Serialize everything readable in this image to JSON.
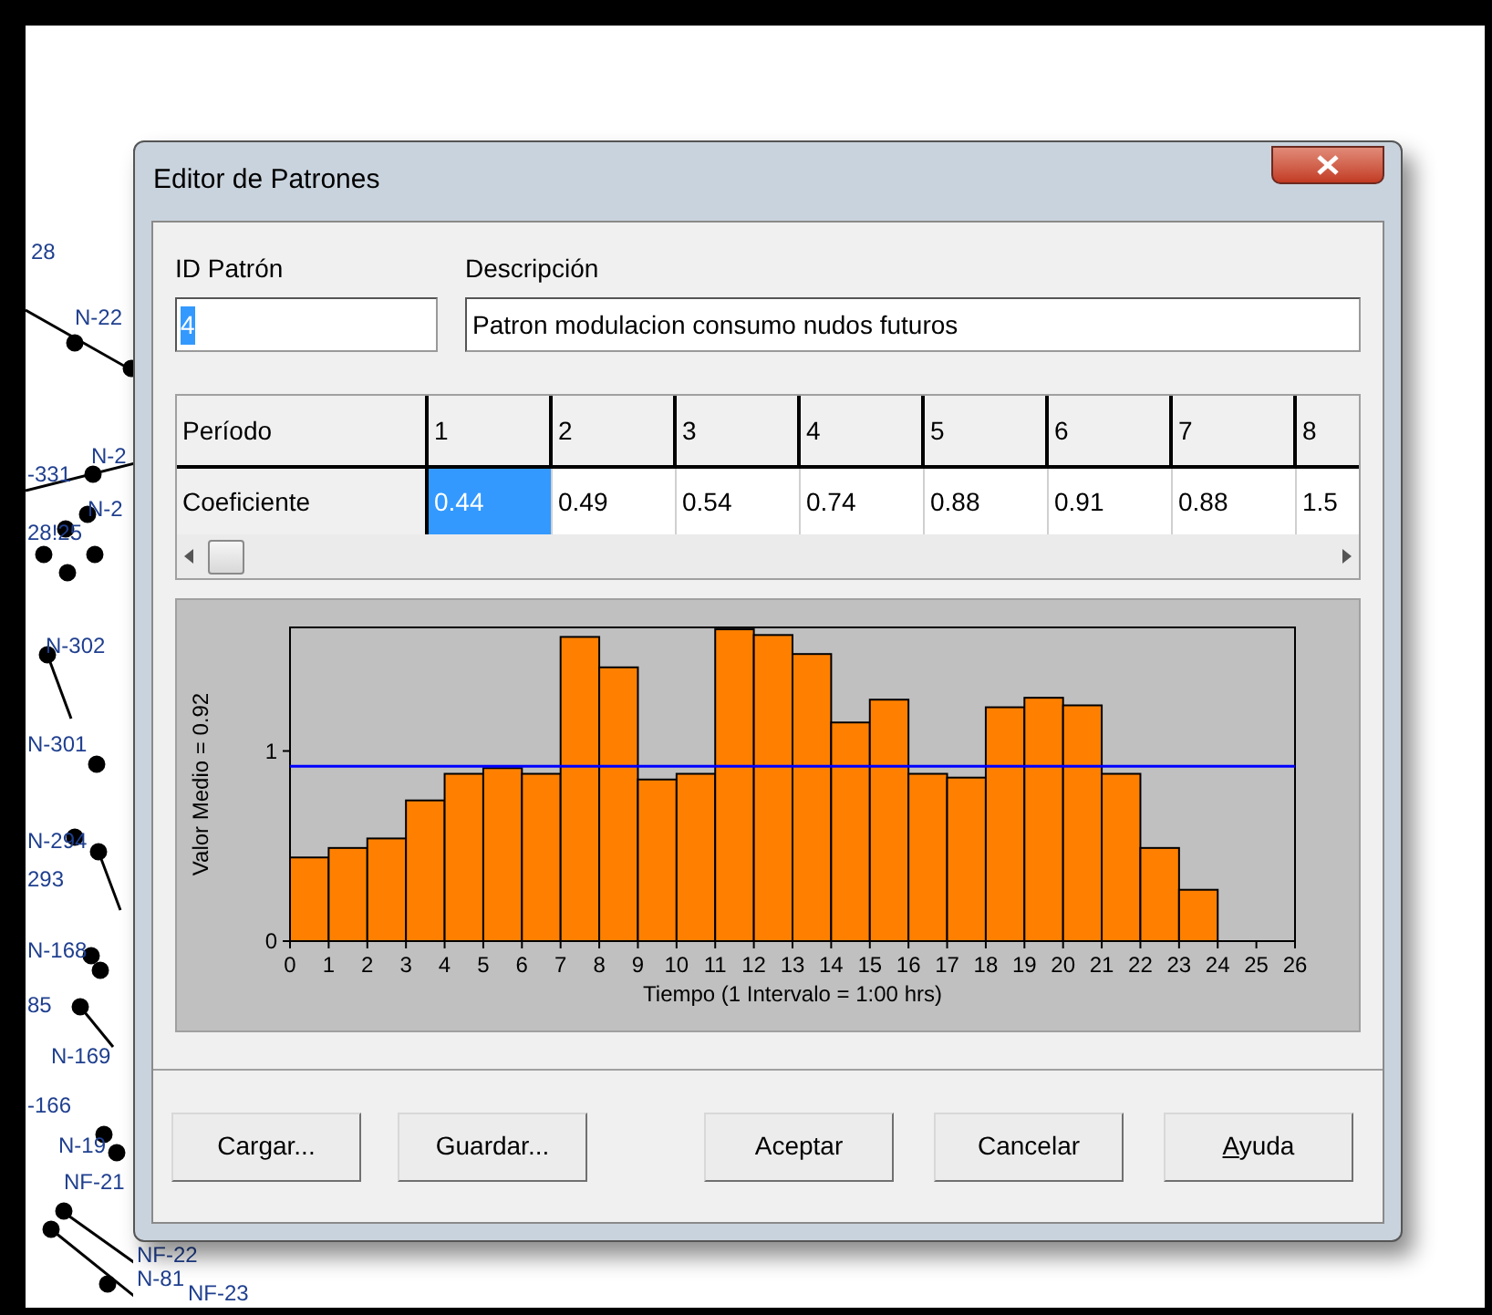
{
  "map": {
    "labels": [
      "28",
      "N-22",
      "-331",
      "N-2",
      "N-2",
      "28!25",
      "N-302",
      "N-301",
      "N-294",
      "293",
      "N-168",
      "85",
      "N-169",
      "-166",
      "N-19",
      "NF-21",
      "NF-22",
      "N-81",
      "NF-23"
    ]
  },
  "window": {
    "title": "Editor de Patrones"
  },
  "id_field": {
    "label": "ID Patrón",
    "value": "4",
    "highlighted": true
  },
  "description_field": {
    "label": "Descripción",
    "value": "Patron modulacion consumo nudos futuros"
  },
  "table": {
    "row_headers": [
      "Período",
      "Coeficiente"
    ],
    "periods": [
      "1",
      "2",
      "3",
      "4",
      "5",
      "6",
      "7",
      "8"
    ],
    "coefficients": [
      {
        "text": "0.44",
        "selected": true
      },
      {
        "text": "0.49",
        "selected": false
      },
      {
        "text": "0.54",
        "selected": false
      },
      {
        "text": "0.74",
        "selected": false
      },
      {
        "text": "0.88",
        "selected": false
      },
      {
        "text": "0.91",
        "selected": false
      },
      {
        "text": "0.88",
        "selected": false
      },
      {
        "text": "1.5",
        "selected": false
      }
    ]
  },
  "chart": {
    "chart_data": {
      "type": "bar",
      "xlabel": "Tiempo (1 Intervalo = 1:00  hrs)",
      "ylabel": "Valor Medio = 0.92",
      "x": [
        0.5,
        1.5,
        2.5,
        3.5,
        4.5,
        5.5,
        6.5,
        7.5,
        8.5,
        9.5,
        10.5,
        11.5,
        12.5,
        13.5,
        14.5,
        15.5,
        16.5,
        17.5,
        18.5,
        19.5,
        20.5,
        21.5,
        22.5,
        23.5
      ],
      "series": [
        {
          "color": "#ff8000",
          "values": [
            0.44,
            0.49,
            0.54,
            0.74,
            0.88,
            0.91,
            0.88,
            1.6,
            1.44,
            0.85,
            0.88,
            1.64,
            1.61,
            1.51,
            1.15,
            1.27,
            0.88,
            0.86,
            1.23,
            1.28,
            1.24,
            0.88,
            0.49,
            0.27
          ]
        }
      ],
      "xlim": [
        0,
        26
      ],
      "ylim": [
        0,
        1.65
      ],
      "xticks": [
        0,
        1,
        2,
        3,
        4,
        5,
        6,
        7,
        8,
        9,
        10,
        11,
        12,
        13,
        14,
        15,
        16,
        17,
        18,
        19,
        20,
        21,
        22,
        23,
        24,
        25,
        26
      ],
      "yticks": [
        0,
        1
      ],
      "ref_lines": [
        {
          "axis": "y",
          "value": 0.92,
          "color": "#0000ff"
        }
      ]
    }
  },
  "buttons": [
    {
      "label": "Cargar...",
      "mnemonic": false
    },
    {
      "label": "Guardar...",
      "mnemonic": false
    },
    {
      "label": "Aceptar",
      "mnemonic": false
    },
    {
      "label": "Cancelar",
      "mnemonic": false
    },
    {
      "label": "Ayuda",
      "mnemonic": true
    }
  ]
}
